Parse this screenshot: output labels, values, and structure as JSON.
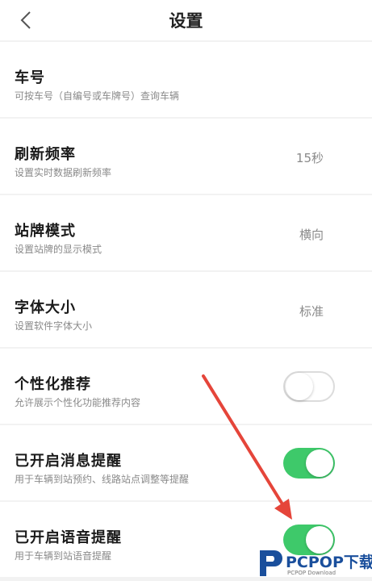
{
  "header": {
    "title": "设置",
    "back_icon": "chevron-left-icon"
  },
  "settings": [
    {
      "title": "车号",
      "desc": "可按车号（自编号或车牌号）查询车辆",
      "value": ""
    },
    {
      "title": "刷新频率",
      "desc": "设置实时数据刷新频率",
      "value": "15秒"
    },
    {
      "title": "站牌模式",
      "desc": "设置站牌的显示模式",
      "value": "横向"
    },
    {
      "title": "字体大小",
      "desc": "设置软件字体大小",
      "value": "标准"
    },
    {
      "title": "个性化推荐",
      "desc": "允许展示个性化功能推荐内容",
      "toggle": "off"
    },
    {
      "title": "已开启消息提醒",
      "desc": "用于车辆到站预约、线路站点调整等提醒",
      "toggle": "on"
    },
    {
      "title": "已开启语音提醒",
      "desc": "用于车辆到站语音提醒",
      "toggle": "on"
    }
  ],
  "watermark": {
    "brand": "PCPOP下载",
    "sub": "PCPOP Download"
  },
  "colors": {
    "toggle_on": "#3ec96a",
    "arrow": "#e5453a",
    "brand": "#1a4f9c"
  }
}
